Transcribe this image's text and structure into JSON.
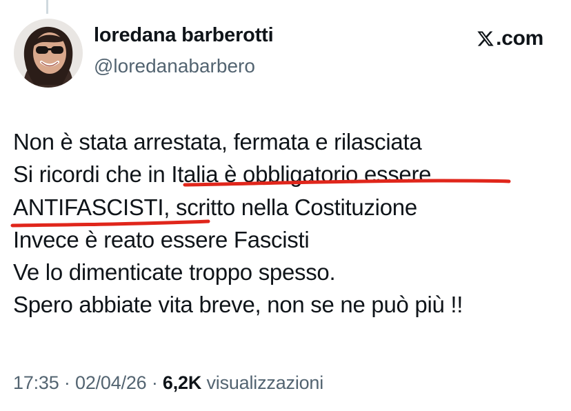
{
  "author": {
    "name": "loredana barberotti",
    "handle": "@loredanabarbero",
    "avatar_icon": "profile-photo-avatar"
  },
  "brand": {
    "label": ".com",
    "icon": "x-logo-icon"
  },
  "tweet": {
    "lines": [
      "Non è stata arrestata, fermata e rilasciata",
      "Si ricordi che in Italia è obbligatorio essere",
      "ANTIFASCISTI, scritto nella Costituzione",
      "Invece è reato essere Fascisti",
      "Ve lo dimenticate troppo spesso.",
      "Spero abbiate vita breve, non se ne può più !!"
    ],
    "annotation_color": "#e0261b"
  },
  "meta": {
    "time": "17:35",
    "separator": "·",
    "date": "02/04/26",
    "views_count": "6,2K",
    "views_label": "visualizzazioni"
  }
}
